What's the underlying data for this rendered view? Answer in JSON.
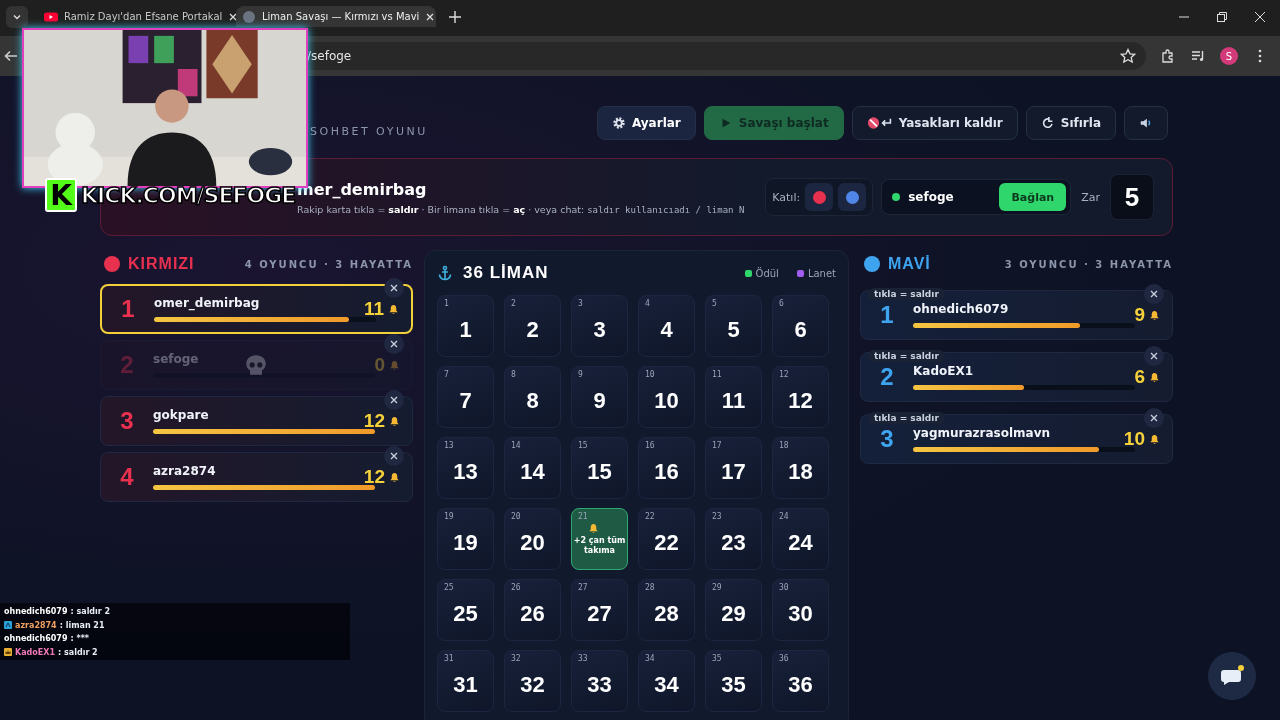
{
  "browser": {
    "tabs": [
      {
        "title": "Ramiz Dayı'dan Efsane Portakal",
        "selected": false,
        "kind": "video"
      },
      {
        "title": "Liman Savaşı — Kırmızı vs Mavi",
        "selected": true,
        "kind": "globe"
      }
    ],
    "address": "/sefoge",
    "profile": "S"
  },
  "overlay": {
    "logo_letter": "K",
    "channel": "KICK.COM/SEFOGE"
  },
  "header": {
    "subtitle": "SOHBET OYUNU",
    "buttons": [
      {
        "label": "Ayarlar",
        "kind": "settings",
        "disabled": false
      },
      {
        "label": "Savaşı başlat",
        "kind": "start",
        "disabled": true
      },
      {
        "label": "Yasakları kaldır",
        "kind": "unban",
        "disabled": false
      },
      {
        "label": "Sıfırla",
        "kind": "reset",
        "disabled": false
      },
      {
        "kind": "sound",
        "disabled": false
      }
    ]
  },
  "banner": {
    "title": "mer_demirbag",
    "hint": "Rakip karta tıkla = **saldır** · Bir limana tıkla = **aç** · veya chat:",
    "hint_code": "saldır kullanıcıadı / liman N",
    "join_label": "Katıl:",
    "join_teams": [
      {
        "color": "#e8304f"
      },
      {
        "color": "#4f86e8"
      }
    ],
    "channel": {
      "value": "sefoge",
      "connected": true
    },
    "connect_button": "Bağlan",
    "dice_label": "Zar",
    "dice": "5"
  },
  "red_team": {
    "name": "KIRMIZI",
    "color": "#e8304f",
    "summary": "4 OYUNCU · 3 HAYATTA",
    "players": [
      {
        "rank": "1",
        "name": "omer_demirbag",
        "bells": "11",
        "level": 0.88,
        "selected": true,
        "dead": false
      },
      {
        "rank": "2",
        "name": "sefoge",
        "bells": "0",
        "level": 0,
        "selected": false,
        "dead": true
      },
      {
        "rank": "3",
        "name": "gokpare",
        "bells": "12",
        "level": 1,
        "selected": false,
        "dead": false
      },
      {
        "rank": "4",
        "name": "azra2874",
        "bells": "12",
        "level": 1,
        "selected": false,
        "dead": false
      }
    ]
  },
  "board": {
    "title": "36 LİMAN",
    "legend": [
      {
        "label": "Ödül",
        "color": "#2fd66b"
      },
      {
        "label": "Lanet",
        "color": "#a35cf0"
      }
    ],
    "ports": [
      {
        "label": "1",
        "value": "1",
        "kind": "hidden"
      },
      {
        "label": "2",
        "value": "2",
        "kind": "hidden"
      },
      {
        "label": "3",
        "value": "3",
        "kind": "hidden"
      },
      {
        "label": "4",
        "value": "4",
        "kind": "hidden"
      },
      {
        "label": "5",
        "value": "5",
        "kind": "hidden"
      },
      {
        "label": "6",
        "value": "6",
        "kind": "hidden"
      },
      {
        "label": "7",
        "value": "7",
        "kind": "hidden"
      },
      {
        "label": "8",
        "value": "8",
        "kind": "hidden"
      },
      {
        "label": "9",
        "value": "9",
        "kind": "hidden"
      },
      {
        "label": "10",
        "value": "10",
        "kind": "hidden"
      },
      {
        "label": "11",
        "value": "11",
        "kind": "hidden"
      },
      {
        "label": "12",
        "value": "12",
        "kind": "hidden"
      },
      {
        "label": "13",
        "value": "13",
        "kind": "hidden"
      },
      {
        "label": "14",
        "value": "14",
        "kind": "hidden"
      },
      {
        "label": "15",
        "value": "15",
        "kind": "hidden"
      },
      {
        "label": "16",
        "value": "16",
        "kind": "hidden"
      },
      {
        "label": "17",
        "value": "17",
        "kind": "hidden"
      },
      {
        "label": "18",
        "value": "18",
        "kind": "hidden"
      },
      {
        "label": "19",
        "value": "19",
        "kind": "hidden"
      },
      {
        "label": "20",
        "value": "20",
        "kind": "hidden"
      },
      {
        "label": "21",
        "value": "+2 çan tüm takıma",
        "kind": "reward"
      },
      {
        "label": "22",
        "value": "22",
        "kind": "hidden"
      },
      {
        "label": "23",
        "value": "23",
        "kind": "hidden"
      },
      {
        "label": "24",
        "value": "24",
        "kind": "hidden"
      },
      {
        "label": "25",
        "value": "25",
        "kind": "hidden"
      },
      {
        "label": "26",
        "value": "26",
        "kind": "hidden"
      },
      {
        "label": "27",
        "value": "27",
        "kind": "hidden"
      },
      {
        "label": "28",
        "value": "28",
        "kind": "hidden"
      },
      {
        "label": "29",
        "value": "29",
        "kind": "hidden"
      },
      {
        "label": "30",
        "value": "30",
        "kind": "hidden"
      },
      {
        "label": "31",
        "value": "31",
        "kind": "hidden"
      },
      {
        "label": "32",
        "value": "32",
        "kind": "hidden"
      },
      {
        "label": "33",
        "value": "33",
        "kind": "hidden"
      },
      {
        "label": "34",
        "value": "34",
        "kind": "hidden"
      },
      {
        "label": "35",
        "value": "35",
        "kind": "hidden"
      },
      {
        "label": "36",
        "value": "36",
        "kind": "hidden"
      }
    ]
  },
  "blue_team": {
    "name": "MAVİ",
    "color": "#3fa4f0",
    "summary": "3 OYUNCU · 3 HAYATTA",
    "players": [
      {
        "rank": "1",
        "name": "ohnedich6079",
        "bells": "9",
        "level": 0.75,
        "selected": false,
        "dead": false,
        "tag": "tıkla = saldır"
      },
      {
        "rank": "2",
        "name": "KadoEX1",
        "bells": "6",
        "level": 0.5,
        "selected": false,
        "dead": false,
        "tag": "tıkla = saldır"
      },
      {
        "rank": "3",
        "name": "yagmurazrasolmavn",
        "bells": "10",
        "level": 0.84,
        "selected": false,
        "dead": false,
        "tag": "tıkla = saldır"
      }
    ]
  },
  "chat": [
    {
      "user": "ohnedich6079",
      "text": ": saldır 2",
      "color": "#ffffff",
      "kind": "plain"
    },
    {
      "user": "azra2874",
      "text": ": liman 21",
      "color": "#f0a060",
      "kind": "boxed"
    },
    {
      "user": "ohnedich6079",
      "text": ": ***",
      "color": "#ffffff",
      "kind": "plain"
    },
    {
      "user": "KadoEX1",
      "text": ": saldır 2",
      "color": "#f07ab8",
      "kind": "crowned"
    }
  ]
}
